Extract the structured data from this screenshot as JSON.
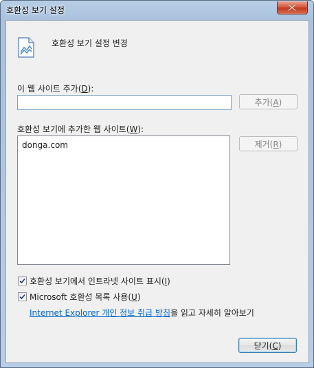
{
  "window": {
    "title": "호환성 보기 설정"
  },
  "header": {
    "text": "호환성 보기 설정 변경",
    "icon": "document-settings-icon"
  },
  "add_site": {
    "label_prefix": "이 웹 사이트 추가(",
    "label_key": "D",
    "label_suffix": "):",
    "input_value": "",
    "button_prefix": "추가(",
    "button_key": "A",
    "button_suffix": ")"
  },
  "site_list": {
    "label_prefix": "호환성 보기에 추가한 웹 사이트(",
    "label_key": "W",
    "label_suffix": "):",
    "items": [
      "donga.com"
    ],
    "remove_prefix": "제거(",
    "remove_key": "R",
    "remove_suffix": ")"
  },
  "options": {
    "intranet_prefix": "호환성 보기에서 인트라넷 사이트 표시(",
    "intranet_key": "I",
    "intranet_suffix": ")",
    "intranet_checked": true,
    "ms_list_prefix": "Microsoft 호환성 목록 사용(",
    "ms_list_key": "U",
    "ms_list_suffix": ")",
    "ms_list_checked": true
  },
  "privacy": {
    "link_text": "Internet Explorer 개인 정보 취급 방침",
    "after_text": "을 읽고 자세히 알아보기"
  },
  "footer": {
    "close_prefix": "닫기(",
    "close_key": "C",
    "close_suffix": ")"
  },
  "colors": {
    "link": "#0066cc",
    "title_gradient_top": "#b7cde6",
    "close_button": "#c3391d"
  }
}
